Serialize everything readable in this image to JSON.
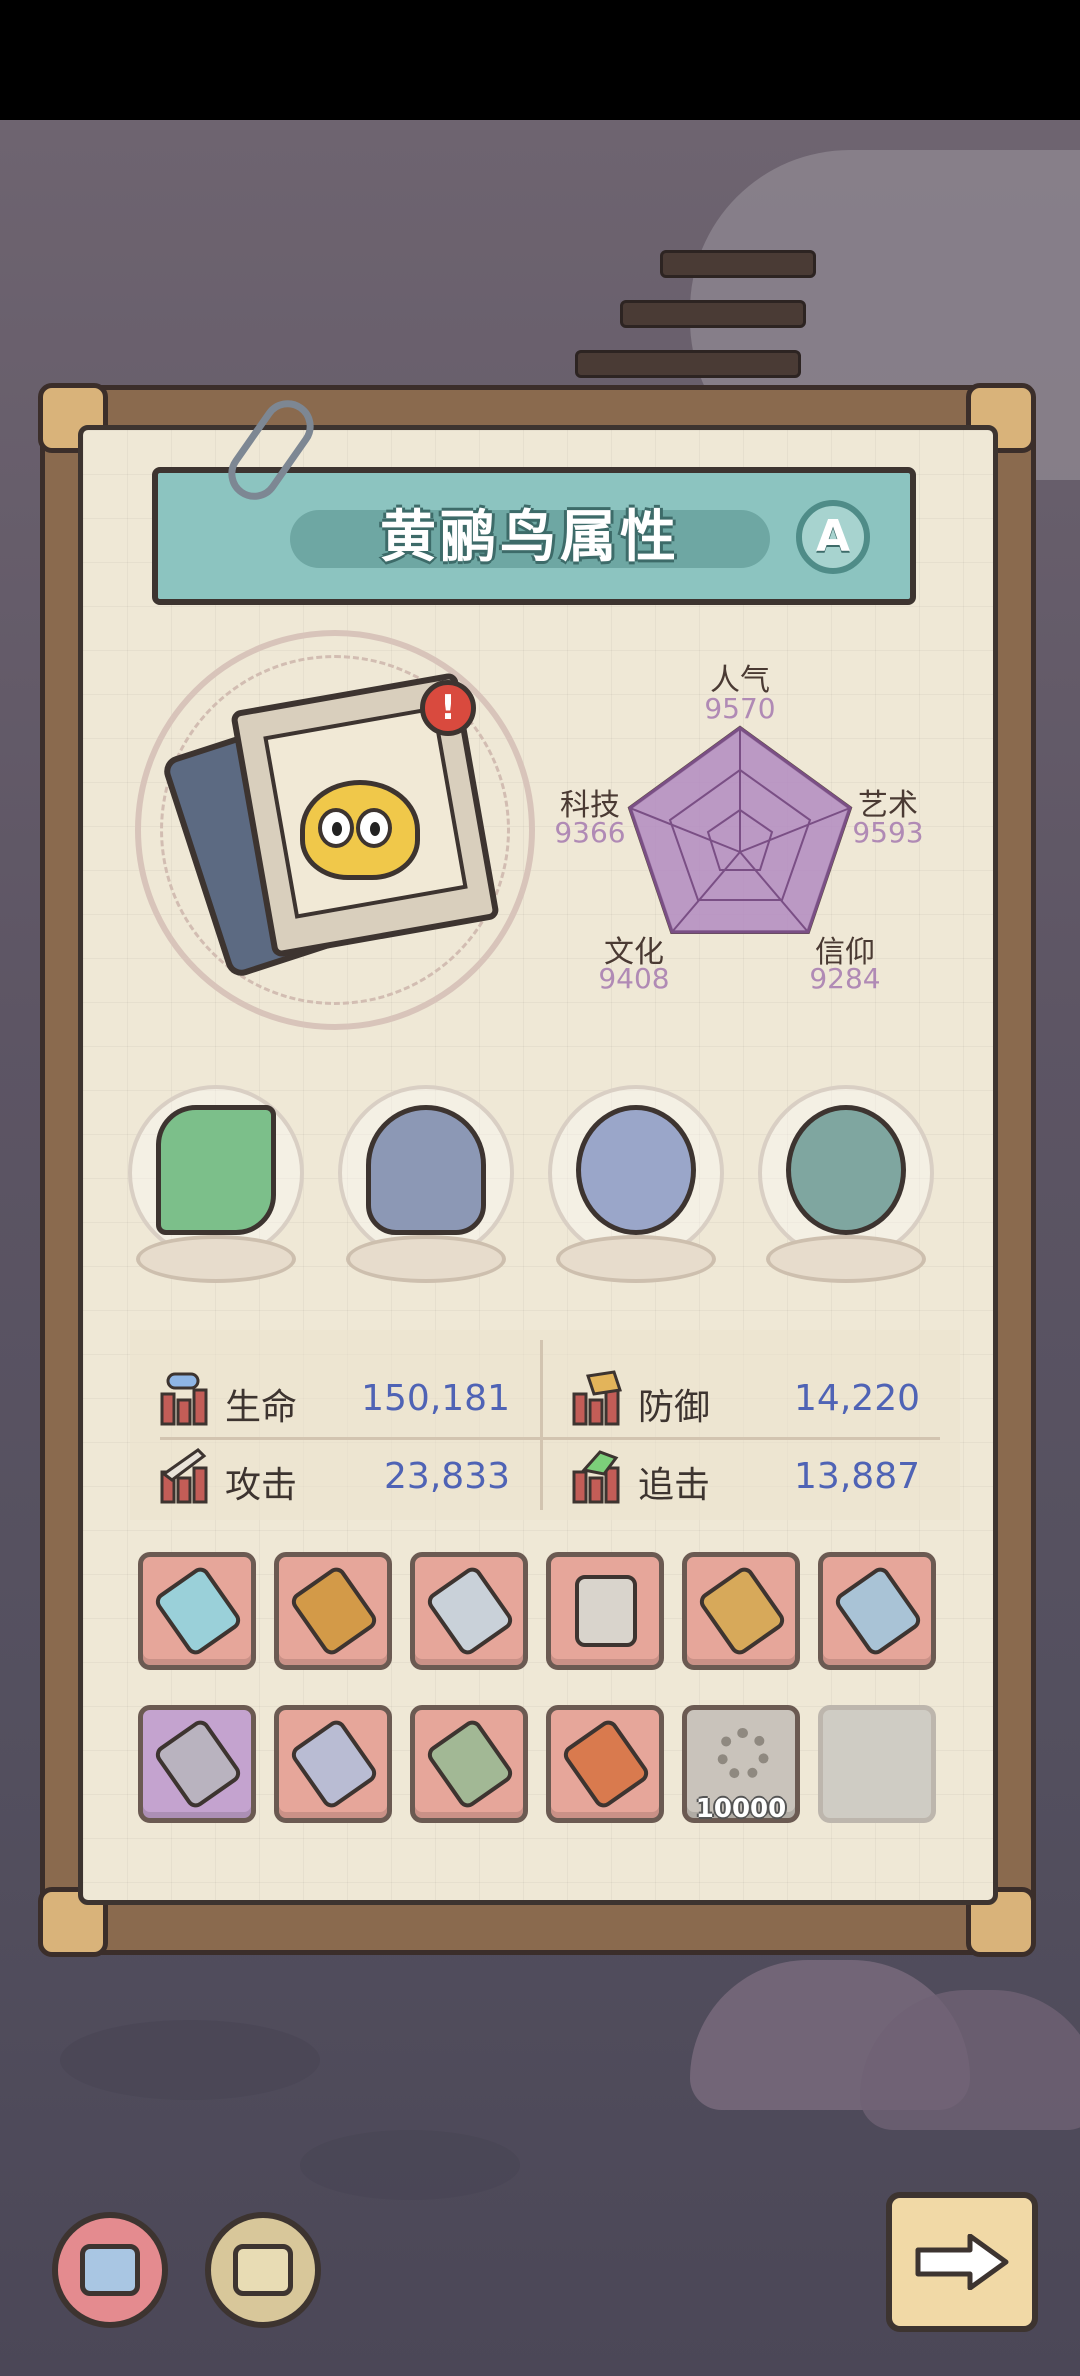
{
  "window": {
    "title": "黄鹂鸟属性",
    "grade": "A"
  },
  "radar": {
    "stats": [
      {
        "label": "人气",
        "value": "9570"
      },
      {
        "label": "艺术",
        "value": "9593"
      },
      {
        "label": "信仰",
        "value": "9284"
      },
      {
        "label": "文化",
        "value": "9408"
      },
      {
        "label": "科技",
        "value": "9366"
      }
    ],
    "fill_color": "#b18bc1"
  },
  "relics": [
    {
      "name": "dna-helix-relic"
    },
    {
      "name": "crystal-shell-relic"
    },
    {
      "name": "compass-relic"
    },
    {
      "name": "vortex-orb-relic"
    }
  ],
  "stats": {
    "hp": {
      "label": "生命",
      "value": "150,181"
    },
    "defense": {
      "label": "防御",
      "value": "14,220"
    },
    "attack": {
      "label": "攻击",
      "value": "23,833"
    },
    "pursuit": {
      "label": "追击",
      "value": "13,887"
    }
  },
  "equipment": {
    "row1": [
      "feather-spear",
      "spiked-club",
      "rocket-blade",
      "armor-vest",
      "totem-mace",
      "steel-sword"
    ],
    "row2": [
      "chain-flail",
      "bone-axe",
      "war-hammer",
      "flame-trident"
    ],
    "locked_count": "10000"
  },
  "colors": {
    "slot_red": "#e6a69a",
    "slot_purple": "#c4a3cf",
    "accent_teal": "#8cc4c0",
    "stat_number": "#4f63b5"
  }
}
